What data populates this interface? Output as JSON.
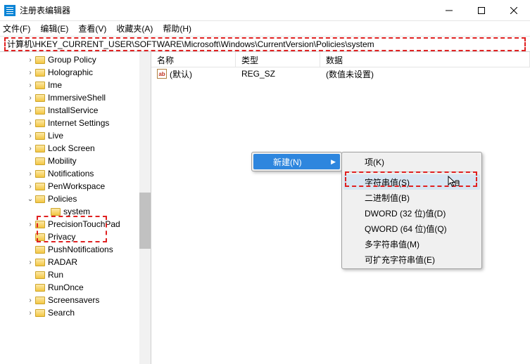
{
  "titlebar": {
    "title": "注册表编辑器"
  },
  "menu": {
    "file": "文件(F)",
    "edit": "编辑(E)",
    "view": "查看(V)",
    "favorites": "收藏夹(A)",
    "help": "帮助(H)"
  },
  "addressbar": {
    "path": "计算机\\HKEY_CURRENT_USER\\SOFTWARE\\Microsoft\\Windows\\CurrentVersion\\Policies\\system"
  },
  "tree": [
    {
      "label": "Group Policy",
      "expander": ">"
    },
    {
      "label": "Holographic",
      "expander": ">"
    },
    {
      "label": "Ime",
      "expander": ">"
    },
    {
      "label": "ImmersiveShell",
      "expander": ">"
    },
    {
      "label": "InstallService",
      "expander": ">"
    },
    {
      "label": "Internet Settings",
      "expander": ">"
    },
    {
      "label": "Live",
      "expander": ">"
    },
    {
      "label": "Lock Screen",
      "expander": ">"
    },
    {
      "label": "Mobility",
      "expander": ""
    },
    {
      "label": "Notifications",
      "expander": ">"
    },
    {
      "label": "PenWorkspace",
      "expander": ">"
    },
    {
      "label": "Policies",
      "expander": "v",
      "children": [
        {
          "label": "system"
        }
      ]
    },
    {
      "label": "PrecisionTouchPad",
      "expander": ">"
    },
    {
      "label": "Privacy",
      "expander": ""
    },
    {
      "label": "PushNotifications",
      "expander": ""
    },
    {
      "label": "RADAR",
      "expander": ">"
    },
    {
      "label": "Run",
      "expander": ""
    },
    {
      "label": "RunOnce",
      "expander": ""
    },
    {
      "label": "Screensavers",
      "expander": ">"
    },
    {
      "label": "Search",
      "expander": ">"
    }
  ],
  "list": {
    "cols": {
      "name": "名称",
      "type": "类型",
      "data": "数据"
    },
    "rows": [
      {
        "icon": "ab",
        "name": "(默认)",
        "type": "REG_SZ",
        "data": "(数值未设置)"
      }
    ]
  },
  "context": {
    "new": "新建(N)",
    "items": {
      "key": "项(K)",
      "string": "字符串值(S)",
      "binary": "二进制值(B)",
      "dword": "DWORD (32 位)值(D)",
      "qword": "QWORD (64 位)值(Q)",
      "multi": "多字符串值(M)",
      "expand": "可扩充字符串值(E)"
    }
  }
}
